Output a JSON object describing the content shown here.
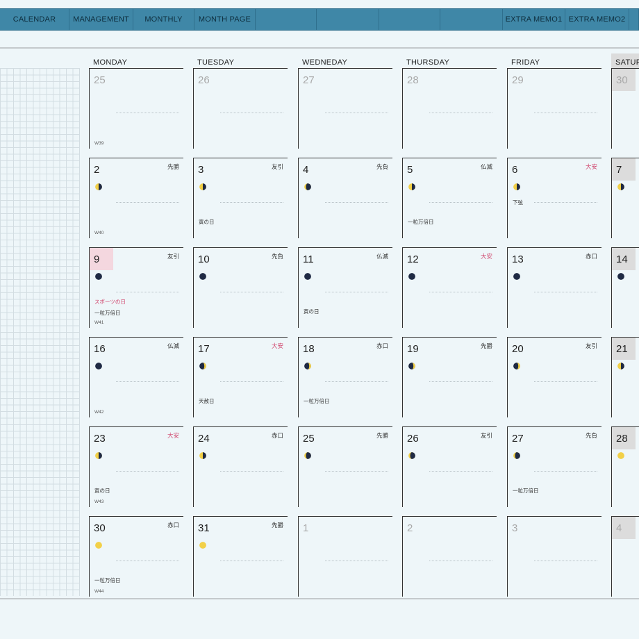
{
  "nav": {
    "tabs_left": [
      "CALENDAR",
      "MANAGEMENT",
      "MONTHLY",
      "MONTH PAGE"
    ],
    "tabs_right": [
      "EXTRA MEMO1",
      "EXTRA MEMO2"
    ]
  },
  "weekdays": [
    "MONDAY",
    "TUESDAY",
    "WEDNEDAY",
    "THURSDAY",
    "FRIDAY",
    "SATUR"
  ],
  "weeks": [
    [
      {
        "day": "25",
        "other": true,
        "week": "W39"
      },
      {
        "day": "26",
        "other": true
      },
      {
        "day": "27",
        "other": true
      },
      {
        "day": "28",
        "other": true
      },
      {
        "day": "29",
        "other": true
      },
      {
        "day": "30",
        "other": true,
        "sat": true
      }
    ],
    [
      {
        "day": "2",
        "rokuyo": "先勝",
        "moon": "first-quarter",
        "week": "W40"
      },
      {
        "day": "3",
        "rokuyo": "友引",
        "moon": "first-quarter",
        "note2": "寅の日"
      },
      {
        "day": "4",
        "rokuyo": "先負",
        "moon": "waxing-gibbous"
      },
      {
        "day": "5",
        "rokuyo": "仏滅",
        "moon": "first-quarter",
        "note2": "一粒万倍日"
      },
      {
        "day": "6",
        "rokuyo": "大安",
        "rokuyo_red": true,
        "moon": "first-quarter",
        "note1": "下弦"
      },
      {
        "day": "7",
        "moon": "first-quarter",
        "sat": true
      }
    ],
    [
      {
        "day": "9",
        "rokuyo": "友引",
        "moon": "new",
        "highlight": true,
        "note2": "スポーツの日",
        "note2_red": true,
        "note3": "一粒万倍日",
        "week": "W41"
      },
      {
        "day": "10",
        "rokuyo": "先負",
        "moon": "new"
      },
      {
        "day": "11",
        "rokuyo": "仏滅",
        "moon": "new",
        "note2": "寅の日"
      },
      {
        "day": "12",
        "rokuyo": "大安",
        "rokuyo_red": true,
        "moon": "new"
      },
      {
        "day": "13",
        "rokuyo": "赤口",
        "moon": "new"
      },
      {
        "day": "14",
        "moon": "new",
        "sat": true
      }
    ],
    [
      {
        "day": "16",
        "rokuyo": "仏滅",
        "moon": "new",
        "week": "W42"
      },
      {
        "day": "17",
        "rokuyo": "大安",
        "rokuyo_red": true,
        "moon": "waxing-crescent",
        "note2": "天赦日"
      },
      {
        "day": "18",
        "rokuyo": "赤口",
        "moon": "waxing-crescent",
        "note2": "一粒万倍日"
      },
      {
        "day": "19",
        "rokuyo": "先勝",
        "moon": "waxing-crescent"
      },
      {
        "day": "20",
        "rokuyo": "友引",
        "moon": "waxing-crescent"
      },
      {
        "day": "21",
        "moon": "first-quarter",
        "sat": true
      }
    ],
    [
      {
        "day": "23",
        "rokuyo": "大安",
        "rokuyo_red": true,
        "moon": "first-quarter",
        "note2": "寅の日",
        "week": "W43"
      },
      {
        "day": "24",
        "rokuyo": "赤口",
        "moon": "first-quarter"
      },
      {
        "day": "25",
        "rokuyo": "先勝",
        "moon": "waxing-gibbous"
      },
      {
        "day": "26",
        "rokuyo": "友引",
        "moon": "waxing-gibbous"
      },
      {
        "day": "27",
        "rokuyo": "先負",
        "moon": "waxing-gibbous",
        "note2": "一粒万倍日"
      },
      {
        "day": "28",
        "moon": "full",
        "sat": true
      }
    ],
    [
      {
        "day": "30",
        "rokuyo": "赤口",
        "moon": "full",
        "note2": "一粒万倍日",
        "week": "W44"
      },
      {
        "day": "31",
        "rokuyo": "先勝",
        "moon": "full"
      },
      {
        "day": "1",
        "other": true
      },
      {
        "day": "2",
        "other": true
      },
      {
        "day": "3",
        "other": true
      },
      {
        "day": "4",
        "other": true,
        "sat": true
      }
    ]
  ],
  "colors": {
    "nav_bg": "#3f87a7",
    "page_bg": "#eef6f9",
    "holiday_red": "#d0436b",
    "today_highlight": "#f4d7df",
    "saturday_bg": "#dcdcdc"
  }
}
